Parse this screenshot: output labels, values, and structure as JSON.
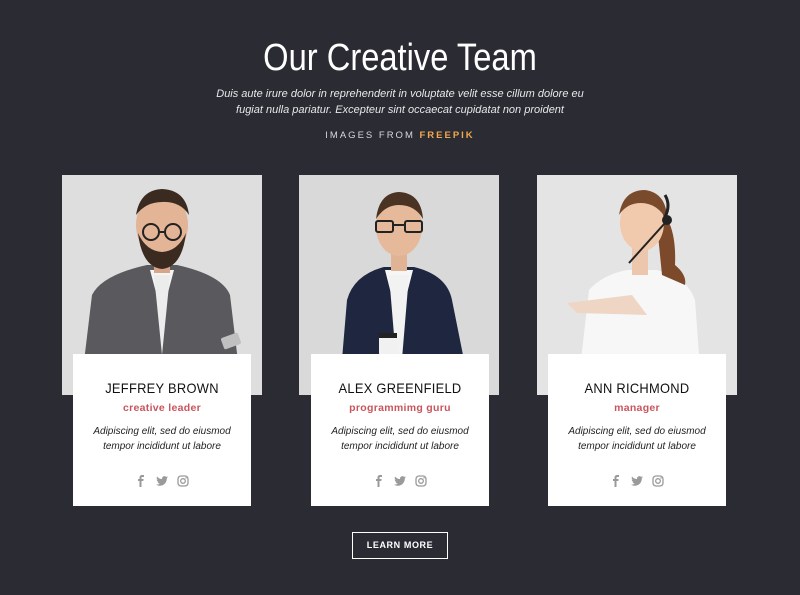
{
  "header": {
    "title": "Our Creative Team",
    "subtitle_line1": "Duis aute irure dolor in reprehenderit in voluptate velit esse cillum dolore eu",
    "subtitle_line2": "fugiat nulla pariatur. Excepteur sint occaecat cupidatat non proident",
    "credit_prefix": "IMAGES FROM",
    "credit_source": "FREEPIK"
  },
  "team": [
    {
      "name": "JEFFREY BROWN",
      "role": "creative leader",
      "desc_line1": "Adipiscing elit, sed do eiusmod",
      "desc_line2": "tempor incididunt ut labore"
    },
    {
      "name": "ALEX GREENFIELD",
      "role": "programmimg guru",
      "desc_line1": "Adipiscing elit, sed do eiusmod",
      "desc_line2": "tempor incididunt ut labore"
    },
    {
      "name": "ANN RICHMOND",
      "role": "manager",
      "desc_line1": "Adipiscing elit, sed do eiusmod",
      "desc_line2": "tempor incididunt ut labore"
    }
  ],
  "social_icons": [
    "facebook-icon",
    "twitter-icon",
    "instagram-icon"
  ],
  "cta": {
    "label": "LEARN MORE"
  },
  "colors": {
    "background": "#2a2b33",
    "role": "#c9545d",
    "credit_accent": "#f2a84d",
    "card": "#ffffff"
  }
}
